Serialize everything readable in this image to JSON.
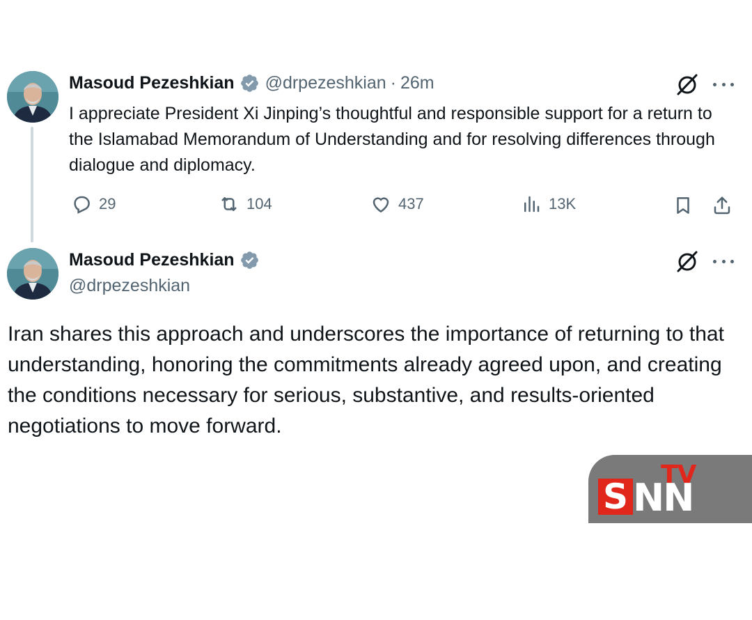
{
  "tweet1": {
    "display_name": "Masoud Pezeshkian",
    "handle": "@drpezeshkian",
    "separator": "·",
    "time": "26m",
    "text": "I appreciate President Xi Jinping’s thoughtful and responsible support for a return to the Islamabad Memorandum of Understanding and for resolving differences through dialogue and diplomacy.",
    "replies": "29",
    "reposts": "104",
    "likes": "437",
    "views": "13K",
    "icons": {
      "avatar": "avatar",
      "verified": "verified-badge-icon",
      "grok": "grok-icon",
      "more": "more-icon",
      "reply": "reply-icon",
      "repost": "repost-icon",
      "like": "like-icon",
      "views": "views-icon",
      "bookmark": "bookmark-icon",
      "share": "share-icon"
    }
  },
  "tweet2": {
    "display_name": "Masoud Pezeshkian",
    "handle": "@drpezeshkian",
    "text": "Iran shares this approach and underscores the importance of returning to that understanding, honoring the commitments already agreed upon, and creating the conditions necessary for serious, substantive, and results-oriented negotiations to move forward."
  },
  "watermark": {
    "tv": "TV",
    "s": "S",
    "nn": "NN"
  },
  "colors": {
    "text_primary": "#0f1419",
    "text_secondary": "#536471",
    "verified_badge": "#829aab",
    "thread_line": "#cfd9de",
    "watermark_bg": "#7a7a7a",
    "watermark_red": "#e1261c"
  }
}
